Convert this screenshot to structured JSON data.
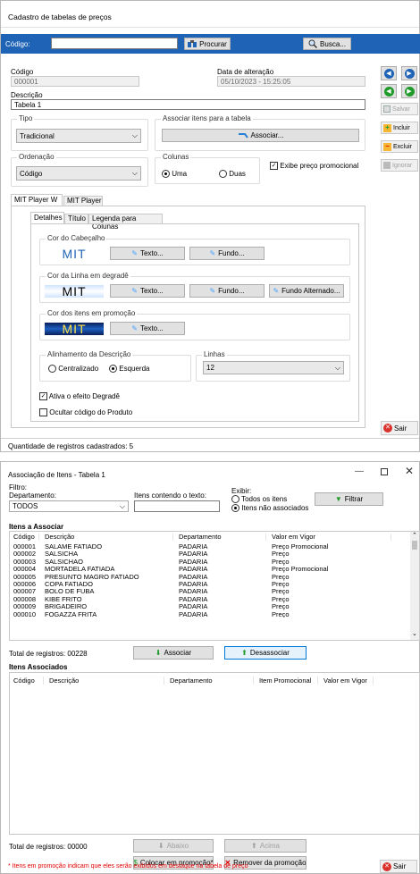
{
  "form1": {
    "title": "Cadastro de tabelas de preços",
    "search": {
      "label": "Código:",
      "value": "",
      "btn_procurar": "Procurar",
      "btn_busca": "Busca..."
    },
    "codigo_label": "Código",
    "codigo_value": "000001",
    "data_label": "Data de alteração",
    "data_value": "05/10/2023 - 15:25:05",
    "descricao_label": "Descrição",
    "descricao_value": "Tabela 1",
    "tipo_label": "Tipo",
    "tipo_value": "Tradicional",
    "associar_label": "Associar itens para a tabela",
    "associar_btn": "Associar...",
    "ordenacao_label": "Ordenação",
    "ordenacao_value": "Código",
    "colunas_label": "Colunas",
    "col_uma": "Uma",
    "col_duas": "Duas",
    "exibe_promo": "Exibe preço promocional",
    "side": {
      "salvar": "Salvar",
      "incluir": "Incluir",
      "excluir": "Excluir",
      "ignorar": "Ignorar",
      "sair": "Sair"
    },
    "tabs": [
      "MIT Player W",
      "MIT Player"
    ],
    "subtabs": [
      "Detalhes",
      "Título",
      "Legenda para Colunas"
    ],
    "cor_cabecalho": "Cor do Cabeçalho",
    "preview_text": "MIT",
    "cor_linha": "Cor da Linha em degradê",
    "cor_promo": "Cor dos itens em promoção",
    "btn_texto": "Texto...",
    "btn_fundo": "Fundo...",
    "btn_fundo_alt": "Fundo Alternado...",
    "alinhamento_label": "Alinhamento da Descrição",
    "al_centralizado": "Centralizado",
    "al_esquerda": "Esquerda",
    "linhas_label": "Linhas",
    "linhas_value": "12",
    "ativa_degrade": "Ativa o efeito Degradê",
    "ocultar_codigo": "Ocultar código do Produto",
    "status": "Quantidade de registros cadastrados:  5"
  },
  "form2": {
    "title": "Associação de Itens - Tabela 1",
    "filtro": "Filtro:",
    "departamento_label": "Departamento:",
    "departamento_value": "TODOS",
    "itens_texto_label": "Itens contendo o texto:",
    "itens_texto_value": "",
    "exibir_label": "Exibir:",
    "exibir_todos": "Todos os itens",
    "exibir_nao": "Itens não associados",
    "filtrar": "Filtrar",
    "section1": "Itens a Associar",
    "cols1": [
      "Código",
      "Descrição",
      "Departamento",
      "Valor em Vigor"
    ],
    "rows1": [
      [
        "000001",
        "SALAME FATIADO",
        "PADARIA",
        "Preço Promocional"
      ],
      [
        "000002",
        "SALSICHA",
        "PADARIA",
        "Preço"
      ],
      [
        "000003",
        "SALSICHAO",
        "PADARIA",
        "Preço"
      ],
      [
        "000004",
        "MORTADELA FATIADA",
        "PADARIA",
        "Preço Promocional"
      ],
      [
        "000005",
        "PRESUNTO MAGRO FATIADO",
        "PADARIA",
        "Preço"
      ],
      [
        "000006",
        "COPA FATIADO",
        "PADARIA",
        "Preço"
      ],
      [
        "000007",
        "BOLO DE FUBA",
        "PADARIA",
        "Preço"
      ],
      [
        "000008",
        "KIBE FRITO",
        "PADARIA",
        "Preço"
      ],
      [
        "000009",
        "BRIGADEIRO",
        "PADARIA",
        "Preço"
      ],
      [
        "000010",
        "FOGAZZA FRITA",
        "PADARIA",
        "Preço"
      ]
    ],
    "total1": "Total de registros: 00228",
    "associar": "Associar",
    "desassociar": "Desassociar",
    "section2": "Itens Associados",
    "cols2": [
      "Código",
      "Descrição",
      "Departamento",
      "Item Promocional",
      "Valor em Vigor"
    ],
    "total2": "Total de registros: 00000",
    "abaixo": "Abaixo",
    "acima": "Acima",
    "colocar_promo": "Colocar em promoção*",
    "remover_promo": "Remover da promoção",
    "footnote": "* Itens em promoção indicam que eles serão exibidos em destaque na tabela de preço",
    "sair": "Sair"
  },
  "colors": {
    "header_blue": "#1e63b5",
    "status_red": "#e30000",
    "promo_bg": "#0a1f5a",
    "yellow": "#ffe24a"
  }
}
